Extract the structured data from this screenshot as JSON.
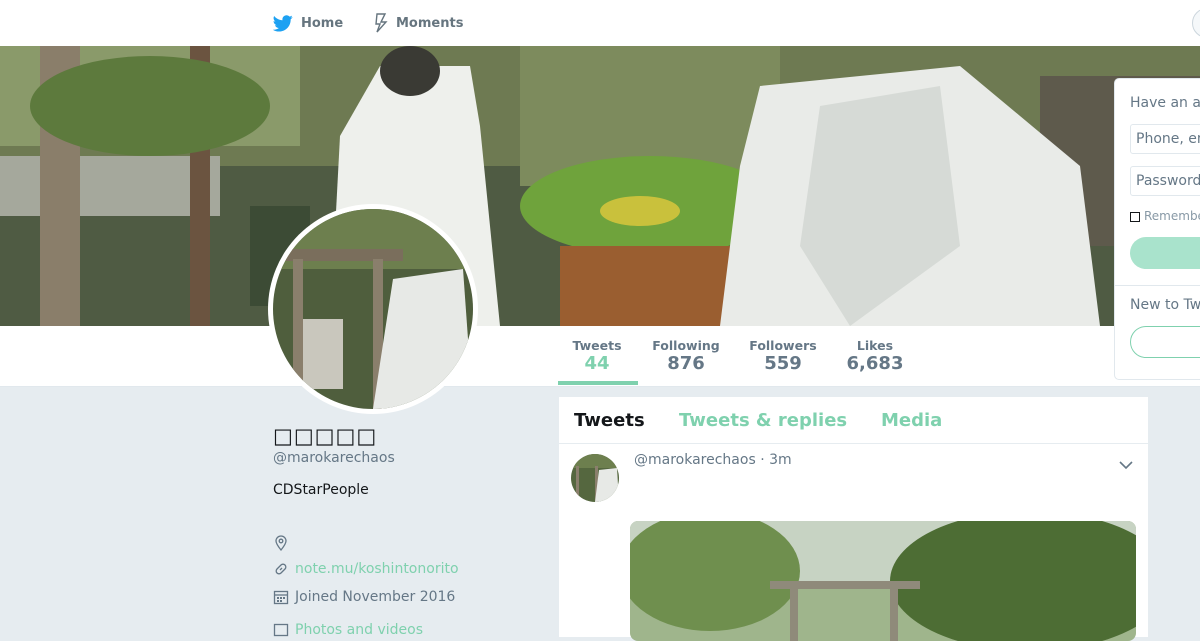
{
  "colors": {
    "accent": "#7fd1ae",
    "nav_text": "#66757f",
    "bg": "#e6ecf0"
  },
  "nav": {
    "home": {
      "icon": "twitter-bird-icon",
      "label": "Home"
    },
    "moments": {
      "icon": "lightning-icon",
      "label": "Moments"
    }
  },
  "stats": [
    {
      "label": "Tweets",
      "value": "44",
      "active": true
    },
    {
      "label": "Following",
      "value": "876"
    },
    {
      "label": "Followers",
      "value": "559"
    },
    {
      "label": "Likes",
      "value": "6,683"
    }
  ],
  "profile": {
    "name": "□□□□□",
    "handle": "@marokarechaos",
    "bio": "CDStarPeople",
    "location_icon": "location-pin-icon",
    "url_icon": "link-icon",
    "url": "note.mu/koshintonorito",
    "joined_icon": "calendar-icon",
    "joined": "Joined November 2016",
    "more_link": "Photos and videos"
  },
  "timeline": {
    "tabs": [
      "Tweets",
      "Tweets & replies",
      "Media"
    ],
    "tweet": {
      "handle": "@marokarechaos",
      "time": "3m",
      "caret_icon": "chevron-down-icon"
    }
  },
  "login": {
    "title": "Have an account?",
    "phone_placeholder": "Phone, email or username",
    "password_placeholder": "Password",
    "remember": "Remember me",
    "new_to": "New to Twitter?"
  }
}
